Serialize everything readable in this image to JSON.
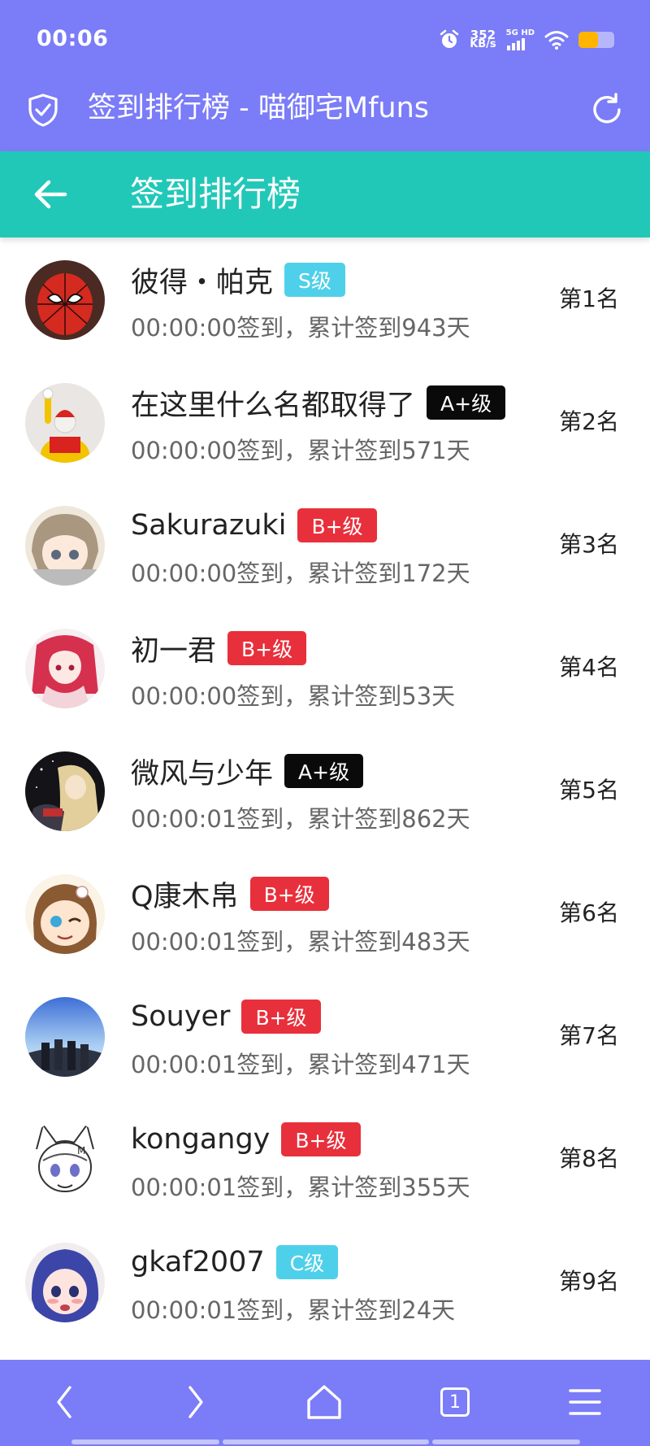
{
  "status_bar": {
    "time": "00:06",
    "speed_value": "352",
    "speed_unit": "KB/s",
    "network_label": "5G HD",
    "battery_level": 0.55,
    "battery_color": "#ffb400"
  },
  "browser": {
    "title": "签到排行榜 - 喵御宅Mfuns",
    "shield_icon": "shield-check-icon",
    "reload_icon": "reload-icon"
  },
  "header": {
    "title": "签到排行榜",
    "back_icon": "back-arrow-icon"
  },
  "colors": {
    "top_bar": "#7b7cf7",
    "app_header": "#21c8b8",
    "badge_S": "#4fd0ea",
    "badge_C": "#4fd0ea",
    "badge_A_plus": "#0a0a0a",
    "badge_B_plus": "#e8303c"
  },
  "entries": [
    {
      "name": "彼得・帕克",
      "badge": "S级",
      "badge_color": "#4fd0ea",
      "meta": "00:00:00签到，累计签到943天",
      "rank": "第1名"
    },
    {
      "name": "在这里什么名都取得了",
      "badge": "A+级",
      "badge_color": "#0a0a0a",
      "meta": "00:00:00签到，累计签到571天",
      "rank": "第2名"
    },
    {
      "name": "Sakurazuki",
      "badge": "B+级",
      "badge_color": "#e8303c",
      "meta": "00:00:00签到，累计签到172天",
      "rank": "第3名"
    },
    {
      "name": "初一君",
      "badge": "B+级",
      "badge_color": "#e8303c",
      "meta": "00:00:00签到，累计签到53天",
      "rank": "第4名"
    },
    {
      "name": "微风与少年",
      "badge": "A+级",
      "badge_color": "#0a0a0a",
      "meta": "00:00:01签到，累计签到862天",
      "rank": "第5名"
    },
    {
      "name": "Q康木帛",
      "badge": "B+级",
      "badge_color": "#e8303c",
      "meta": "00:00:01签到，累计签到483天",
      "rank": "第6名"
    },
    {
      "name": "Souyer",
      "badge": "B+级",
      "badge_color": "#e8303c",
      "meta": "00:00:01签到，累计签到471天",
      "rank": "第7名"
    },
    {
      "name": "kongangy",
      "badge": "B+级",
      "badge_color": "#e8303c",
      "meta": "00:00:01签到，累计签到355天",
      "rank": "第8名"
    },
    {
      "name": "gkaf2007",
      "badge": "C级",
      "badge_color": "#4fd0ea",
      "meta": "00:00:01签到，累计签到24天",
      "rank": "第9名"
    }
  ],
  "bottom_nav": {
    "tab_count": "1",
    "icons": [
      "back-icon",
      "forward-icon",
      "home-icon",
      "tabs-icon",
      "menu-icon"
    ]
  }
}
